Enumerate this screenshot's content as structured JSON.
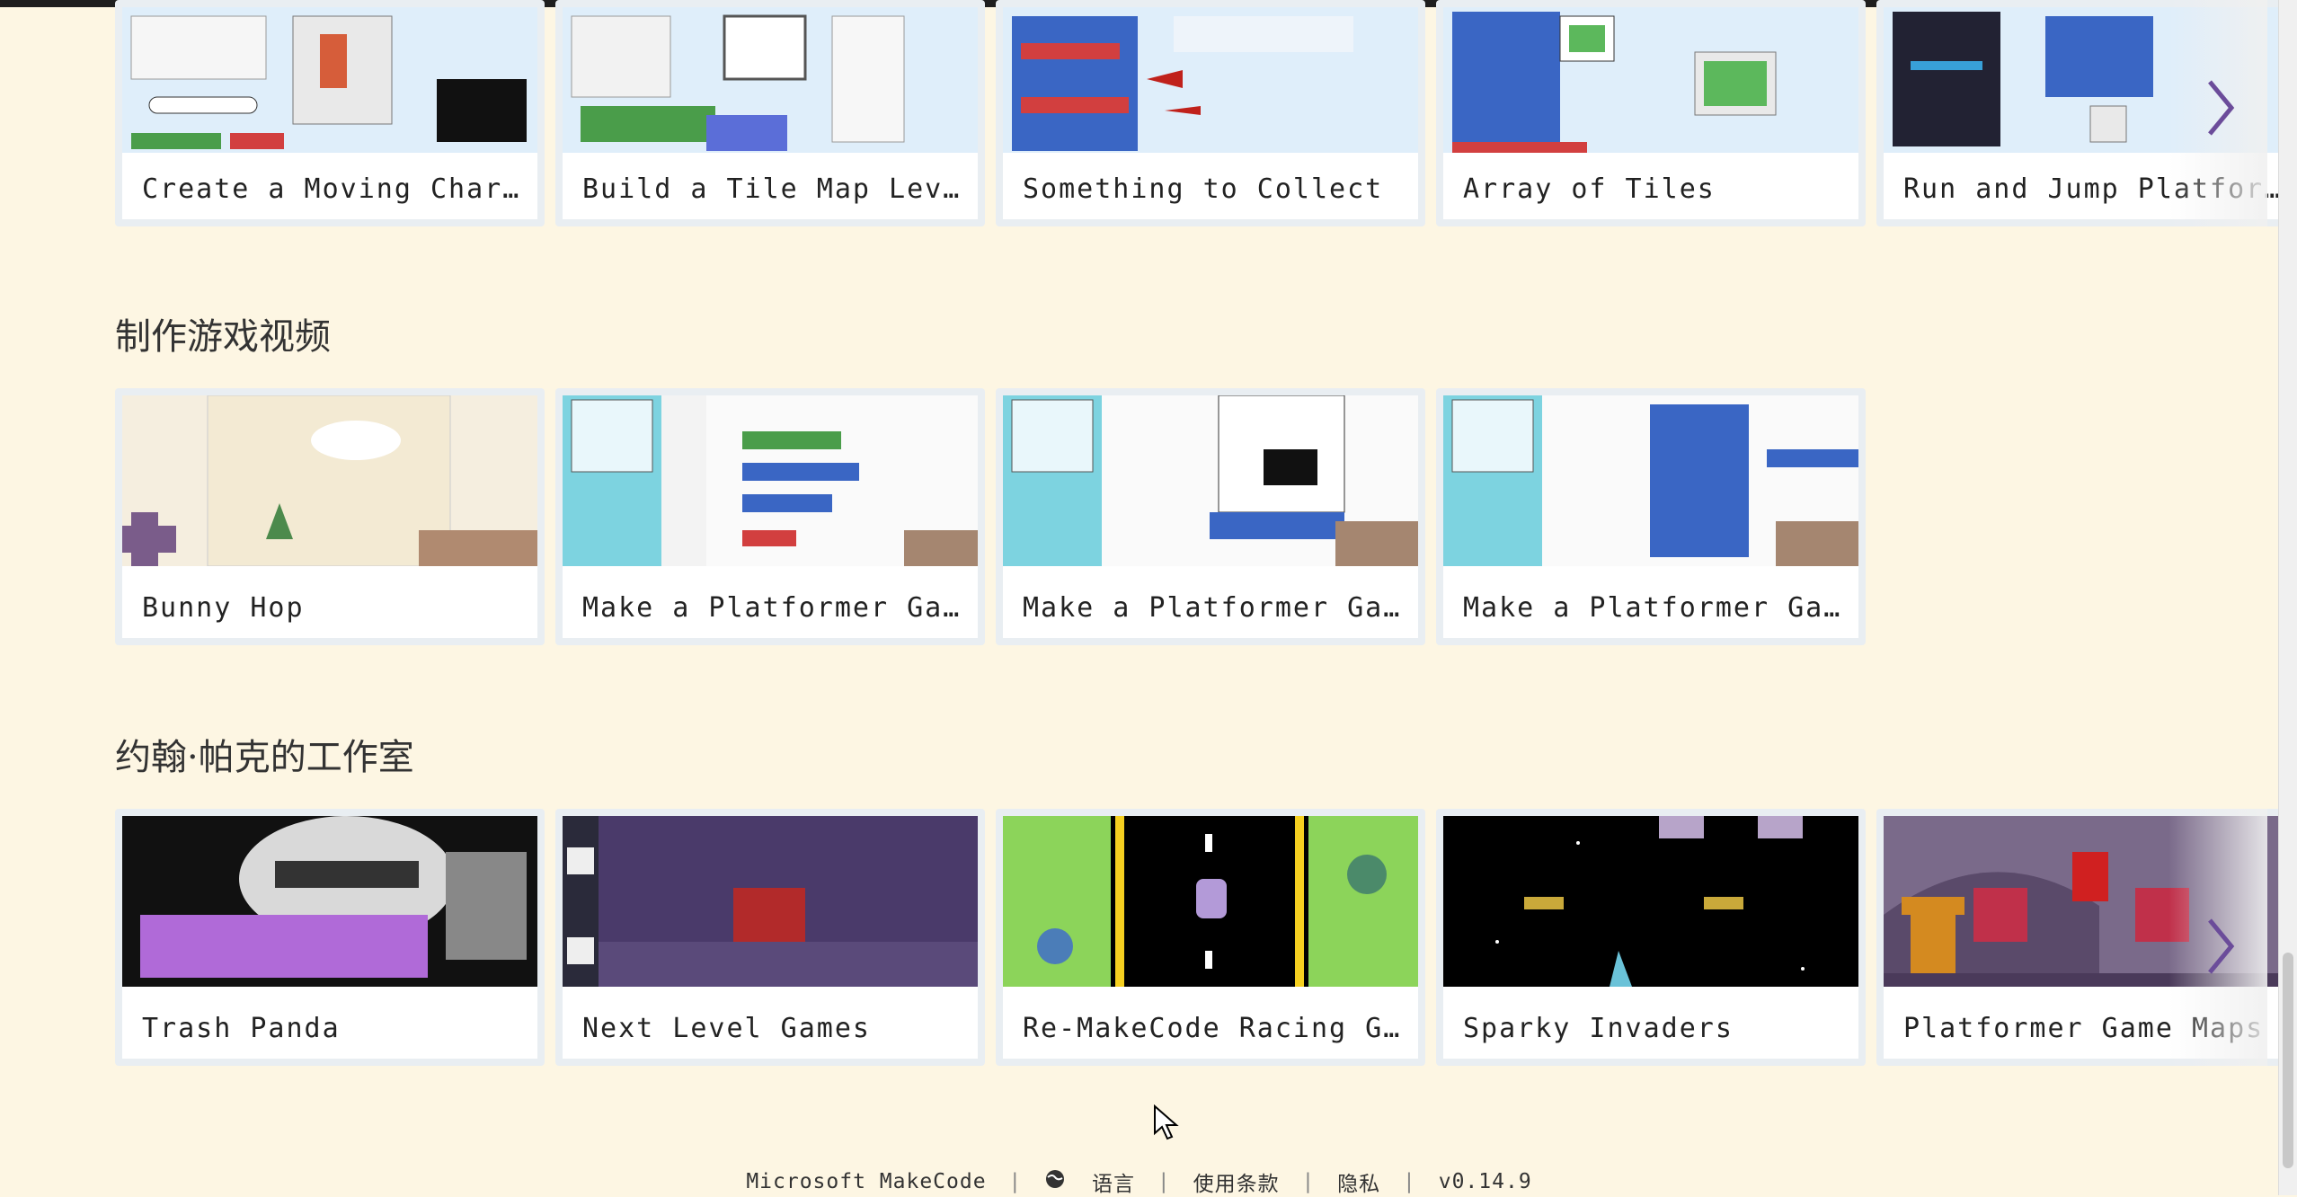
{
  "tutorials": {
    "cards": [
      {
        "label": "Create a Moving Charact…"
      },
      {
        "label": "Build a Tile Map Level"
      },
      {
        "label": "Something to Collect"
      },
      {
        "label": "Array of Tiles"
      },
      {
        "label": "Run and Jump Platformer…"
      }
    ]
  },
  "videos": {
    "title": "制作游戏视频",
    "cards": [
      {
        "label": "Bunny Hop"
      },
      {
        "label": "Make a Platformer Game …"
      },
      {
        "label": "Make a Platformer Game …"
      },
      {
        "label": "Make a Platformer Game …"
      }
    ]
  },
  "studio": {
    "title": "约翰·帕克的工作室",
    "cards": [
      {
        "label": "Trash Panda"
      },
      {
        "label": "Next Level Games"
      },
      {
        "label": "Re-MakeCode Racing Games"
      },
      {
        "label": "Sparky Invaders"
      },
      {
        "label": "Platformer Game Maps"
      }
    ]
  },
  "footer": {
    "brand": "Microsoft MakeCode",
    "language": "语言",
    "terms": "使用条款",
    "privacy": "隐私",
    "version": "v0.14.9"
  },
  "icons": [
    "chevron-right-icon",
    "globe-icon",
    "mouse-cursor-icon"
  ],
  "colors": {
    "background": "#fdf6e3",
    "card_border": "#e9eef2",
    "arrow": "#6b4c9a"
  }
}
